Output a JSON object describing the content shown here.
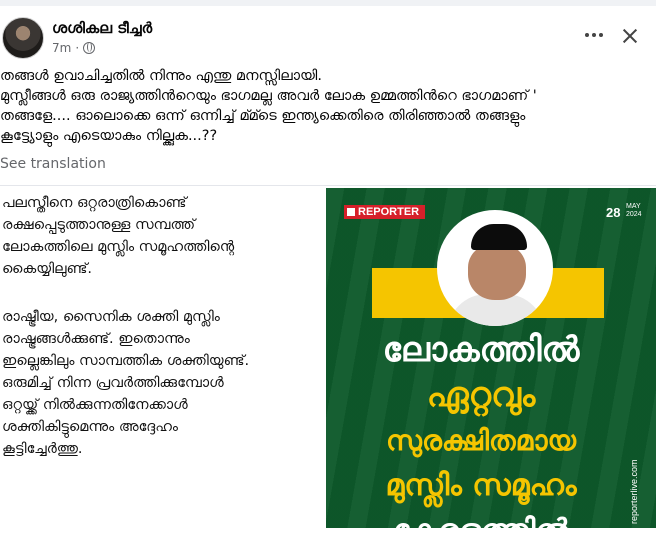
{
  "post": {
    "author": "ശശികല ടീച്ചർ",
    "time": "7m",
    "text_lines": [
      "തങ്ങൾ ഉവാചിച്ചതിൽ നിന്നും എന്തു മനസ്സിലായി.",
      "മുസ്ലീങ്ങൾ ഒരു രാജ്യത്തിൻറെയും ഭാഗമല്ല അവർ ലോക ഉമ്മത്തിൻറെ ഭാഗമാണ് '",
      "തങ്ങളേ.... ഓലൊക്കെ ഒന്ന് ഒന്നിച്ച് മ്മ്ടെ ഇന്ത്യക്കെതിരെ തിരിഞ്ഞാൽ തങ്ങളും",
      "കൂട്ട്യോളും എടെയാകും നില്ക്കുക...??"
    ],
    "see_translation": "See translation"
  },
  "left_image": {
    "paragraph1": [
      "പലസ്തീനെ ഒറ്റരാത്രികൊണ്ട്",
      "രക്ഷപ്പെടുത്താനുള്ള സമ്പത്ത്",
      "ലോകത്തിലെ മുസ്ലിം സമൂഹത്തിന്റെ",
      "കൈയ്യിലുണ്ട്."
    ],
    "paragraph2": [
      "രാഷ്ട്രീയ, സൈനിക ശക്തി മുസ്ലിം",
      "രാഷ്ട്രങ്ങൾക്കുണ്ട്. ഇതൊന്നും",
      "ഇല്ലെങ്കിലും സാമ്പത്തിക ശക്തിയുണ്ട്.",
      "ഒരുമിച്ച് നിന്ന പ്രവർത്തിക്കുമ്പോൾ",
      "ഒറ്റയ്ക്ക് നിൽക്കുന്നതിനേക്കാൾ",
      "ശക്തികിട്ടുമെന്നും അദ്ദേഹം",
      "കൂട്ടിച്ചേർത്തു."
    ]
  },
  "right_image": {
    "brand": "REPORTER",
    "date_day": "28",
    "date_month": "MAY",
    "date_year": "2024",
    "headline": [
      "ലോകത്തിൽ",
      "ഏറ്റവും",
      "സുരക്ഷിതമായ",
      "മുസ്ലിം സമൂഹം",
      "കേരളത്തിൽ"
    ],
    "vertical_text": "reporterlive.com"
  },
  "colors": {
    "bg_green": "#0e5a2b",
    "accent_yellow": "#f5c500",
    "brand_red": "#d6202a",
    "meta_gray": "#65676b"
  },
  "icons": [
    "globe-icon",
    "more-options-icon",
    "close-icon"
  ]
}
